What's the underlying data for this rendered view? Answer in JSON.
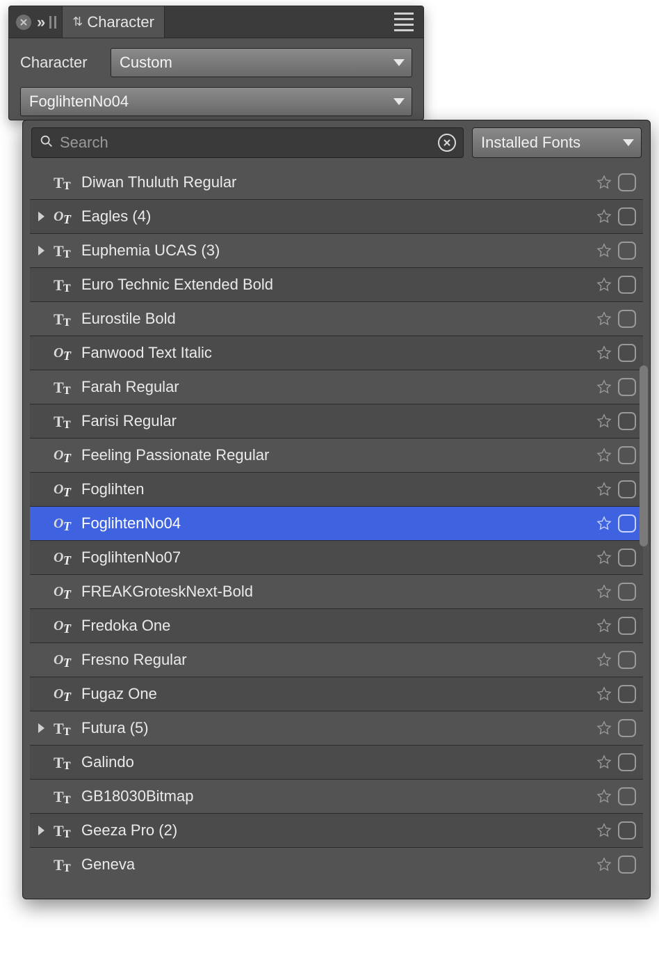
{
  "panel": {
    "tab_label": "Character",
    "label": "Character",
    "preset_value": "Custom",
    "font_value": "FoglihtenNo04"
  },
  "popup": {
    "search_placeholder": "Search",
    "filter_value": "Installed Fonts"
  },
  "fonts": [
    {
      "name": "Diwan Thuluth Regular",
      "icon": "tt",
      "group": false,
      "selected": false
    },
    {
      "name": "Eagles (4)",
      "icon": "ot",
      "group": true,
      "selected": false
    },
    {
      "name": "Euphemia UCAS (3)",
      "icon": "tt",
      "group": true,
      "selected": false
    },
    {
      "name": "Euro Technic Extended Bold",
      "icon": "tt",
      "group": false,
      "selected": false
    },
    {
      "name": "Eurostile Bold",
      "icon": "tt",
      "group": false,
      "selected": false
    },
    {
      "name": "Fanwood Text Italic",
      "icon": "ot",
      "group": false,
      "selected": false
    },
    {
      "name": "Farah Regular",
      "icon": "tt",
      "group": false,
      "selected": false
    },
    {
      "name": "Farisi Regular",
      "icon": "tt",
      "group": false,
      "selected": false
    },
    {
      "name": "Feeling Passionate Regular",
      "icon": "ot",
      "group": false,
      "selected": false
    },
    {
      "name": "Foglihten",
      "icon": "ot",
      "group": false,
      "selected": false
    },
    {
      "name": "FoglihtenNo04",
      "icon": "ot",
      "group": false,
      "selected": true
    },
    {
      "name": "FoglihtenNo07",
      "icon": "ot",
      "group": false,
      "selected": false
    },
    {
      "name": "FREAKGroteskNext-Bold",
      "icon": "ot",
      "group": false,
      "selected": false
    },
    {
      "name": "Fredoka One",
      "icon": "ot",
      "group": false,
      "selected": false
    },
    {
      "name": "Fresno Regular",
      "icon": "ot",
      "group": false,
      "selected": false
    },
    {
      "name": "Fugaz One",
      "icon": "ot",
      "group": false,
      "selected": false
    },
    {
      "name": "Futura (5)",
      "icon": "tt",
      "group": true,
      "selected": false
    },
    {
      "name": "Galindo",
      "icon": "tt",
      "group": false,
      "selected": false
    },
    {
      "name": "GB18030Bitmap",
      "icon": "tt",
      "group": false,
      "selected": false
    },
    {
      "name": "Geeza Pro (2)",
      "icon": "tt",
      "group": true,
      "selected": false
    },
    {
      "name": "Geneva",
      "icon": "tt",
      "group": false,
      "selected": false
    }
  ]
}
